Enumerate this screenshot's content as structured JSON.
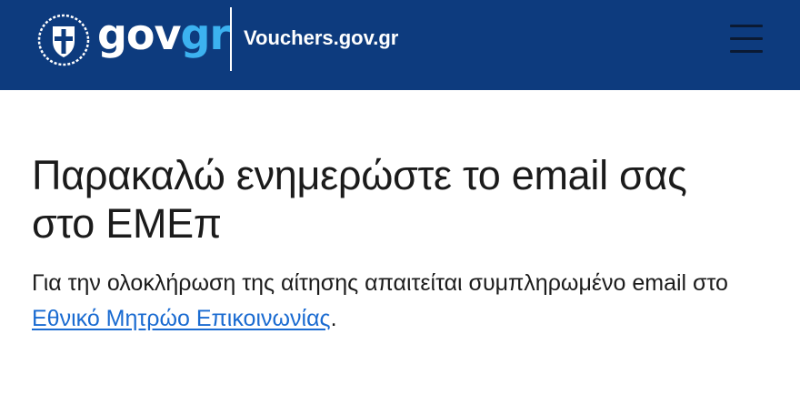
{
  "header": {
    "brand": {
      "part1": "gov",
      "part2": "gr"
    },
    "site_title": "Vouchers.gov.gr",
    "menu_icon": "hamburger-menu-icon",
    "emblem_icon": "greek-coat-of-arms-icon",
    "colors": {
      "background": "#0d3b7e",
      "brand_accent": "#3cb2f0"
    }
  },
  "main": {
    "title": "Παρακαλώ ενημερώστε το email σας στο ΕΜΕπ",
    "intro_text_before": "Για την ολοκλήρωση της αίτησης απαιτείται συμπληρωμένο email στο ",
    "intro_link": "Εθνικό Μητρώο Επικοινωνίας",
    "intro_text_after": ".",
    "link_color": "#1a6bd1"
  }
}
